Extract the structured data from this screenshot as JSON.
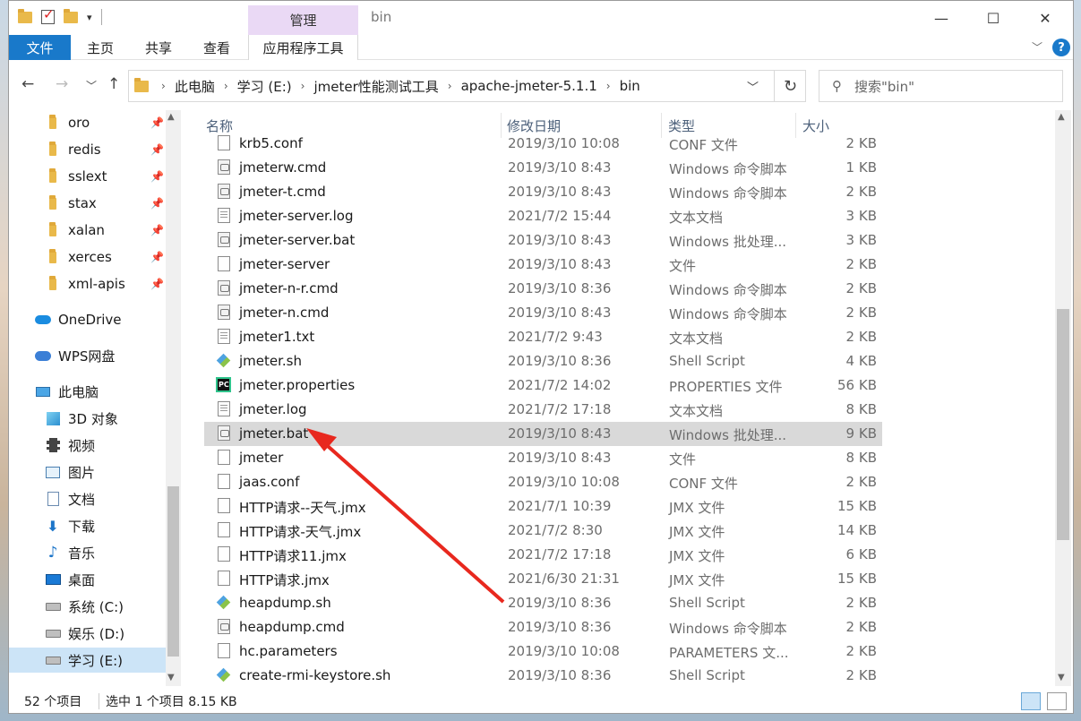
{
  "window": {
    "title": "bin"
  },
  "titlebar": {
    "manage_label": "管理"
  },
  "ribbon": {
    "tabs": [
      "文件",
      "主页",
      "共享",
      "查看"
    ],
    "app_tools_label": "应用程序工具"
  },
  "address": {
    "crumbs": [
      "此电脑",
      "学习 (E:)",
      "jmeter性能测试工具",
      "apache-jmeter-5.1.1",
      "bin"
    ]
  },
  "search": {
    "placeholder": "搜索\"bin\""
  },
  "sidebar": {
    "pinned": [
      "oro",
      "redis",
      "sslext",
      "stax",
      "xalan",
      "xerces",
      "xml-apis"
    ],
    "onedrive": "OneDrive",
    "wps": "WPS网盘",
    "this_pc": "此电脑",
    "pc_items": [
      "3D 对象",
      "视频",
      "图片",
      "文档",
      "下载",
      "音乐",
      "桌面",
      "系统 (C:)",
      "娱乐 (D:)",
      "学习 (E:)"
    ]
  },
  "columns": {
    "name": "名称",
    "date": "修改日期",
    "type": "类型",
    "size": "大小"
  },
  "files": [
    {
      "name": "krb5.conf",
      "date": "2019/3/10 10:08",
      "type": "CONF 文件",
      "size": "2 KB",
      "icon": "file"
    },
    {
      "name": "jmeterw.cmd",
      "date": "2019/3/10 8:43",
      "type": "Windows 命令脚本",
      "size": "1 KB",
      "icon": "cmd"
    },
    {
      "name": "jmeter-t.cmd",
      "date": "2019/3/10 8:43",
      "type": "Windows 命令脚本",
      "size": "2 KB",
      "icon": "cmd"
    },
    {
      "name": "jmeter-server.log",
      "date": "2021/7/2 15:44",
      "type": "文本文档",
      "size": "3 KB",
      "icon": "text"
    },
    {
      "name": "jmeter-server.bat",
      "date": "2019/3/10 8:43",
      "type": "Windows 批处理...",
      "size": "3 KB",
      "icon": "cmd"
    },
    {
      "name": "jmeter-server",
      "date": "2019/3/10 8:43",
      "type": "文件",
      "size": "2 KB",
      "icon": "file"
    },
    {
      "name": "jmeter-n-r.cmd",
      "date": "2019/3/10 8:36",
      "type": "Windows 命令脚本",
      "size": "2 KB",
      "icon": "cmd"
    },
    {
      "name": "jmeter-n.cmd",
      "date": "2019/3/10 8:43",
      "type": "Windows 命令脚本",
      "size": "2 KB",
      "icon": "cmd"
    },
    {
      "name": "jmeter1.txt",
      "date": "2021/7/2 9:43",
      "type": "文本文档",
      "size": "2 KB",
      "icon": "text"
    },
    {
      "name": "jmeter.sh",
      "date": "2019/3/10 8:36",
      "type": "Shell Script",
      "size": "4 KB",
      "icon": "sh"
    },
    {
      "name": "jmeter.properties",
      "date": "2021/7/2 14:02",
      "type": "PROPERTIES 文件",
      "size": "56 KB",
      "icon": "pc"
    },
    {
      "name": "jmeter.log",
      "date": "2021/7/2 17:18",
      "type": "文本文档",
      "size": "8 KB",
      "icon": "text"
    },
    {
      "name": "jmeter.bat",
      "date": "2019/3/10 8:43",
      "type": "Windows 批处理...",
      "size": "9 KB",
      "icon": "cmd",
      "selected": true
    },
    {
      "name": "jmeter",
      "date": "2019/3/10 8:43",
      "type": "文件",
      "size": "8 KB",
      "icon": "file"
    },
    {
      "name": "jaas.conf",
      "date": "2019/3/10 10:08",
      "type": "CONF 文件",
      "size": "2 KB",
      "icon": "file"
    },
    {
      "name": "HTTP请求--天气.jmx",
      "date": "2021/7/1 10:39",
      "type": "JMX 文件",
      "size": "15 KB",
      "icon": "file"
    },
    {
      "name": "HTTP请求-天气.jmx",
      "date": "2021/7/2 8:30",
      "type": "JMX 文件",
      "size": "14 KB",
      "icon": "file"
    },
    {
      "name": "HTTP请求11.jmx",
      "date": "2021/7/2 17:18",
      "type": "JMX 文件",
      "size": "6 KB",
      "icon": "file"
    },
    {
      "name": "HTTP请求.jmx",
      "date": "2021/6/30 21:31",
      "type": "JMX 文件",
      "size": "15 KB",
      "icon": "file"
    },
    {
      "name": "heapdump.sh",
      "date": "2019/3/10 8:36",
      "type": "Shell Script",
      "size": "2 KB",
      "icon": "sh"
    },
    {
      "name": "heapdump.cmd",
      "date": "2019/3/10 8:36",
      "type": "Windows 命令脚本",
      "size": "2 KB",
      "icon": "cmd"
    },
    {
      "name": "hc.parameters",
      "date": "2019/3/10 10:08",
      "type": "PARAMETERS 文...",
      "size": "2 KB",
      "icon": "file"
    },
    {
      "name": "create-rmi-keystore.sh",
      "date": "2019/3/10 8:36",
      "type": "Shell Script",
      "size": "2 KB",
      "icon": "sh"
    }
  ],
  "status": {
    "count": "52 个项目",
    "selection": "选中 1 个项目  8.15 KB"
  },
  "colors": {
    "accent": "#1979ca",
    "selected_row": "#d9d9d9",
    "annotation_arrow": "#e8281e"
  }
}
